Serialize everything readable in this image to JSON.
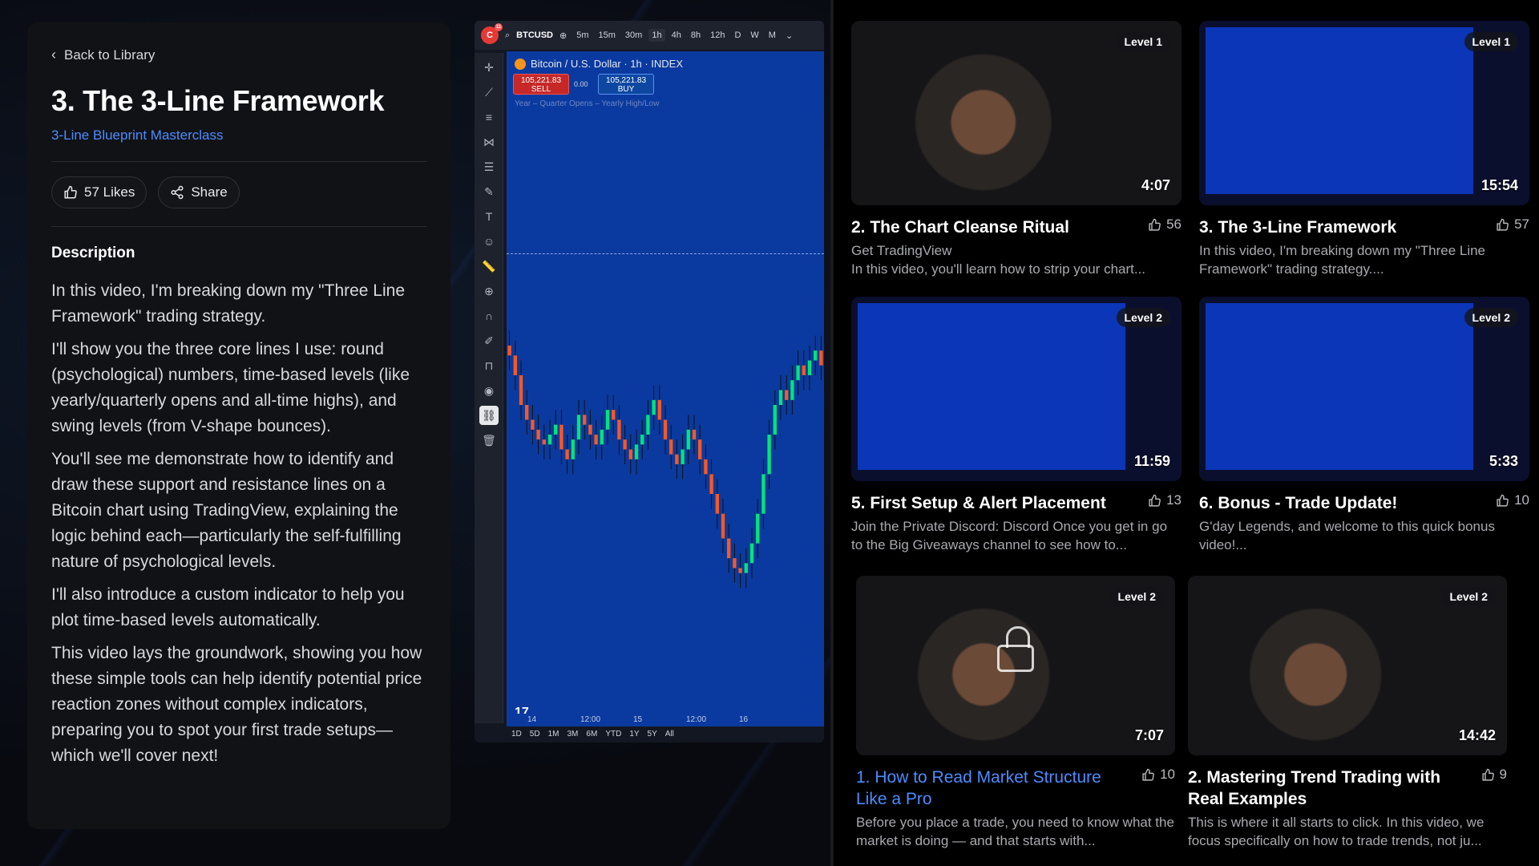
{
  "lesson": {
    "back_label": "Back to Library",
    "title": "3. The 3-Line Framework",
    "course": "3-Line Blueprint Masterclass",
    "likes_label": "57 Likes",
    "share_label": "Share",
    "description_heading": "Description",
    "description": [
      "In this video, I'm breaking down my \"Three Line Framework\" trading strategy.",
      "I'll show you the three core lines I use: round (psychological) numbers, time-based levels (like yearly/quarterly opens and all-time highs), and swing levels (from V-shape bounces).",
      "You'll see me demonstrate how to identify and draw these support and resistance lines on a Bitcoin chart using TradingView, explaining the logic behind each—particularly the self-fulfilling nature of psychological levels.",
      "I'll also introduce a custom indicator to help you plot time-based levels automatically.",
      "This video lays the groundwork, showing you how these simple tools can help identify potential price reaction zones without complex indicators, preparing you to spot your first trade setups—which we'll cover next!"
    ]
  },
  "chart": {
    "logo_badge": "11",
    "symbol": "BTCUSD",
    "timeframes": [
      "5m",
      "15m",
      "30m",
      "1h",
      "4h",
      "8h",
      "12h",
      "D",
      "W",
      "M"
    ],
    "active_timeframe": "1h",
    "legend": "Bitcoin / U.S. Dollar · 1h · INDEX",
    "sell_price": "105,221.83",
    "sell_label": "SELL",
    "spread": "0.00",
    "buy_price": "105,221.83",
    "buy_label": "BUY",
    "indicator_label": "Year – Quarter Opens – Yearly High/Low",
    "watermark": "17",
    "time_labels": [
      "14",
      "12:00",
      "15",
      "12:00",
      "16"
    ],
    "ranges": [
      "1D",
      "5D",
      "1M",
      "3M",
      "6M",
      "YTD",
      "1Y",
      "5Y",
      "All"
    ],
    "candle_up_color": "#00e676",
    "candle_down_color": "#ff5722",
    "background_color": "#0a3a9f"
  },
  "chart_data": {
    "type": "candlestick",
    "title": "Bitcoin / U.S. Dollar · 1h · INDEX",
    "xlabel": "",
    "ylabel": "",
    "x": [
      "14",
      "12:00",
      "15",
      "12:00",
      "16"
    ],
    "closes": [
      62,
      58,
      52,
      49,
      47,
      45,
      44,
      46,
      48,
      43,
      41,
      45,
      50,
      48,
      46,
      44,
      47,
      51,
      49,
      45,
      43,
      41,
      44,
      46,
      50,
      53,
      49,
      45,
      42,
      40,
      43,
      47,
      45,
      41,
      38,
      34,
      30,
      25,
      21,
      19,
      18,
      20,
      24,
      30,
      38,
      46,
      52,
      55,
      53,
      57,
      60,
      58,
      61,
      63,
      60
    ],
    "grid": false
  },
  "cards": [
    {
      "title": "2. The Chart Cleanse Ritual",
      "likes": "56",
      "level": "Level 1",
      "duration": "4:07",
      "desc": "Get TradingView\nIn this video, you'll learn how to strip your chart...",
      "kind": "person",
      "link": false
    },
    {
      "title": "3. The 3-Line Framework",
      "likes": "57",
      "level": "Level 1",
      "duration": "15:54",
      "desc": "In this video, I'm breaking down my \"Three Line Framework\" trading strategy....",
      "kind": "chart",
      "link": false
    },
    {
      "title": "5. First Setup & Alert Placement",
      "likes": "13",
      "level": "Level 2",
      "duration": "11:59",
      "desc": "Join the Private Discord: Discord Once you get in go to the Big Giveaways channel to see how to...",
      "kind": "chart",
      "link": false
    },
    {
      "title": "6. Bonus - Trade Update!",
      "likes": "10",
      "level": "Level 2",
      "duration": "5:33",
      "desc": "G'day Legends, and welcome to this quick bonus video!...",
      "kind": "chart",
      "link": false
    },
    {
      "title": "1. How to Read Market Structure Like a Pro",
      "likes": "10",
      "level": "Level 2",
      "duration": "7:07",
      "desc": "Before you place a trade, you need to know what the market is doing — and that starts with...",
      "kind": "person-locked",
      "link": true
    },
    {
      "title": "2. Mastering Trend Trading with Real Examples",
      "likes": "9",
      "level": "Level 2",
      "duration": "14:42",
      "desc": "This is where it all starts to click. In this video, we focus specifically on how to trade trends, not ju...",
      "kind": "person",
      "link": false
    }
  ]
}
